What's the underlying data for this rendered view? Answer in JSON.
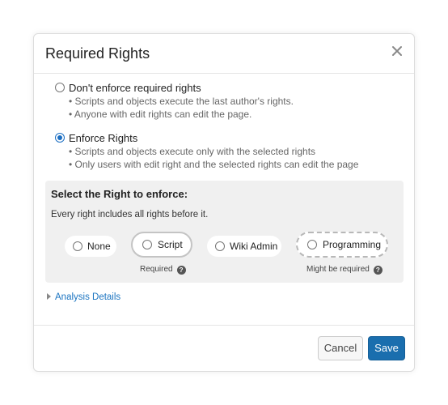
{
  "dialog": {
    "title": "Required Rights",
    "close_icon": "close-icon"
  },
  "options": [
    {
      "label": "Don't enforce required rights",
      "checked": false,
      "bullets": [
        "• Scripts and objects execute the last author's rights.",
        "• Anyone with edit rights can edit the page."
      ]
    },
    {
      "label": "Enforce Rights",
      "checked": true,
      "bullets": [
        "• Scripts and objects execute only with the selected rights",
        "• Only users with edit right and the selected rights can edit the page"
      ]
    }
  ],
  "panel": {
    "title": "Select the Right to enforce:",
    "subtitle": "Every right includes all rights before it.",
    "rights": [
      {
        "label": "None"
      },
      {
        "label": "Script",
        "note": "Required"
      },
      {
        "label": "Wiki Admin"
      },
      {
        "label": "Programming",
        "note": "Might be required"
      }
    ],
    "help_glyph": "?"
  },
  "analysis": {
    "label": "Analysis Details"
  },
  "footer": {
    "cancel_label": "Cancel",
    "save_label": "Save"
  },
  "colors": {
    "accent": "#1b6ec2",
    "save": "#1a6eae",
    "link": "#1b74c1"
  }
}
